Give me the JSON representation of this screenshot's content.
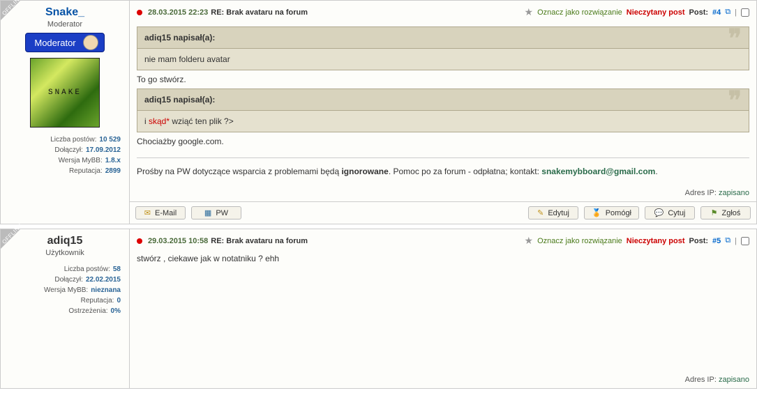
{
  "labels": {
    "offline": "OFFLINE",
    "posts": "Liczba postów:",
    "joined": "Dołączył:",
    "mybb_ver": "Wersja MyBB:",
    "reputation": "Reputacja:",
    "warnings": "Ostrzeżenia:",
    "mark_solution": "Oznacz jako rozwiązanie",
    "unread": "Nieczytany post",
    "post": "Post:",
    "ip": "Adres IP:",
    "saved": "zapisano"
  },
  "buttons": {
    "email": "E-Mail",
    "pw": "PW",
    "edit": "Edytuj",
    "helped": "Pomógł",
    "quote": "Cytuj",
    "report": "Zgłoś"
  },
  "chart_data": null,
  "posts": [
    {
      "user": {
        "name": "Snake_",
        "title": "Moderator",
        "badge": "Moderator",
        "avatar_text": "SNAKE",
        "stats": {
          "posts": "10 529",
          "joined": "17.09.2012",
          "mybb": "1.8.x",
          "rep": "2899"
        }
      },
      "head": {
        "date": "28.03.2015 22:23",
        "subject": "RE: Brak avataru na forum",
        "num": "#4"
      },
      "quotes": [
        {
          "author": "adiq15 napisał(a):",
          "body": "nie mam folderu avatar"
        },
        {
          "author": "adiq15 napisał(a):",
          "body_prefix": "i ",
          "body_red": "skąd*",
          "body_suffix": " wziąć ten plik ?>"
        }
      ],
      "reply1": "To go stwórz.",
      "reply2": "Chociażby google.com.",
      "sig": {
        "text1": "Prośby na PW dotyczące wsparcia z problemami będą ",
        "bold": "ignorowane",
        "text2": ". Pomoc po za forum - odpłatna; kontakt: ",
        "email": "snakemybboard@gmail.com",
        "text3": "."
      }
    },
    {
      "user": {
        "name": "adiq15",
        "title": "Użytkownik",
        "stats": {
          "posts": "58",
          "joined": "22.02.2015",
          "mybb": "nieznana",
          "rep": "0",
          "warn": "0%"
        }
      },
      "head": {
        "date": "29.03.2015 10:58",
        "subject": "RE: Brak avataru na forum",
        "num": "#5"
      },
      "body": "stwórz , ciekawe jak w notatniku ? ehh"
    }
  ]
}
